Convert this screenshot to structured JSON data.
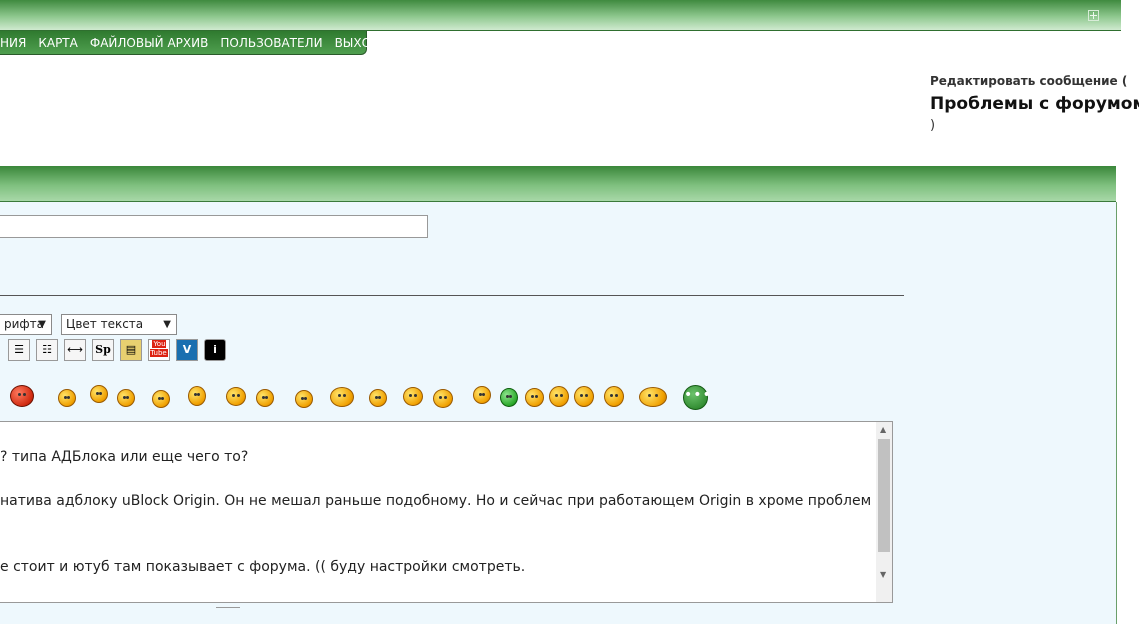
{
  "top_bar": {
    "expand_icon": "expand-icon"
  },
  "nav": {
    "items": [
      {
        "label": "НИЯ"
      },
      {
        "label": "КАРТА"
      },
      {
        "label": "ФАЙЛОВЫЙ АРХИВ"
      },
      {
        "label": "ПОЛЬЗОВАТЕЛИ"
      },
      {
        "label": "ВЫХОД"
      }
    ]
  },
  "edit": {
    "label": "Редактировать сообщение (",
    "title": "Проблемы с форумом",
    "close_paren": ")"
  },
  "editor": {
    "font_select": "рифта",
    "color_select": "Цвет текста",
    "toolbar_icons": [
      "list-icon",
      "numbered-list-icon",
      "horizontal-rule-icon",
      "spoiler-icon",
      "image-gallery-icon",
      "youtube-icon",
      "vimeo-icon",
      "info-icon"
    ],
    "spoiler_label": "Sp",
    "youtube_label": "You Tube",
    "vimeo_label": "V",
    "info_label": "i",
    "more_smilies_label": "•••",
    "text_lines": [
      "? типа АДБлока или еще чего то?",
      "натива адблоку uBlock Origin. Он не мешал раньше подобному. Но и сейчас при работающем Origin в хроме проблем нет с",
      "е стоит и ютуб там показывает с форума. ((  буду настройки смотреть."
    ]
  },
  "colors": {
    "accent_green": "#3f8a3f",
    "panel_bg": "#eef8fd"
  }
}
